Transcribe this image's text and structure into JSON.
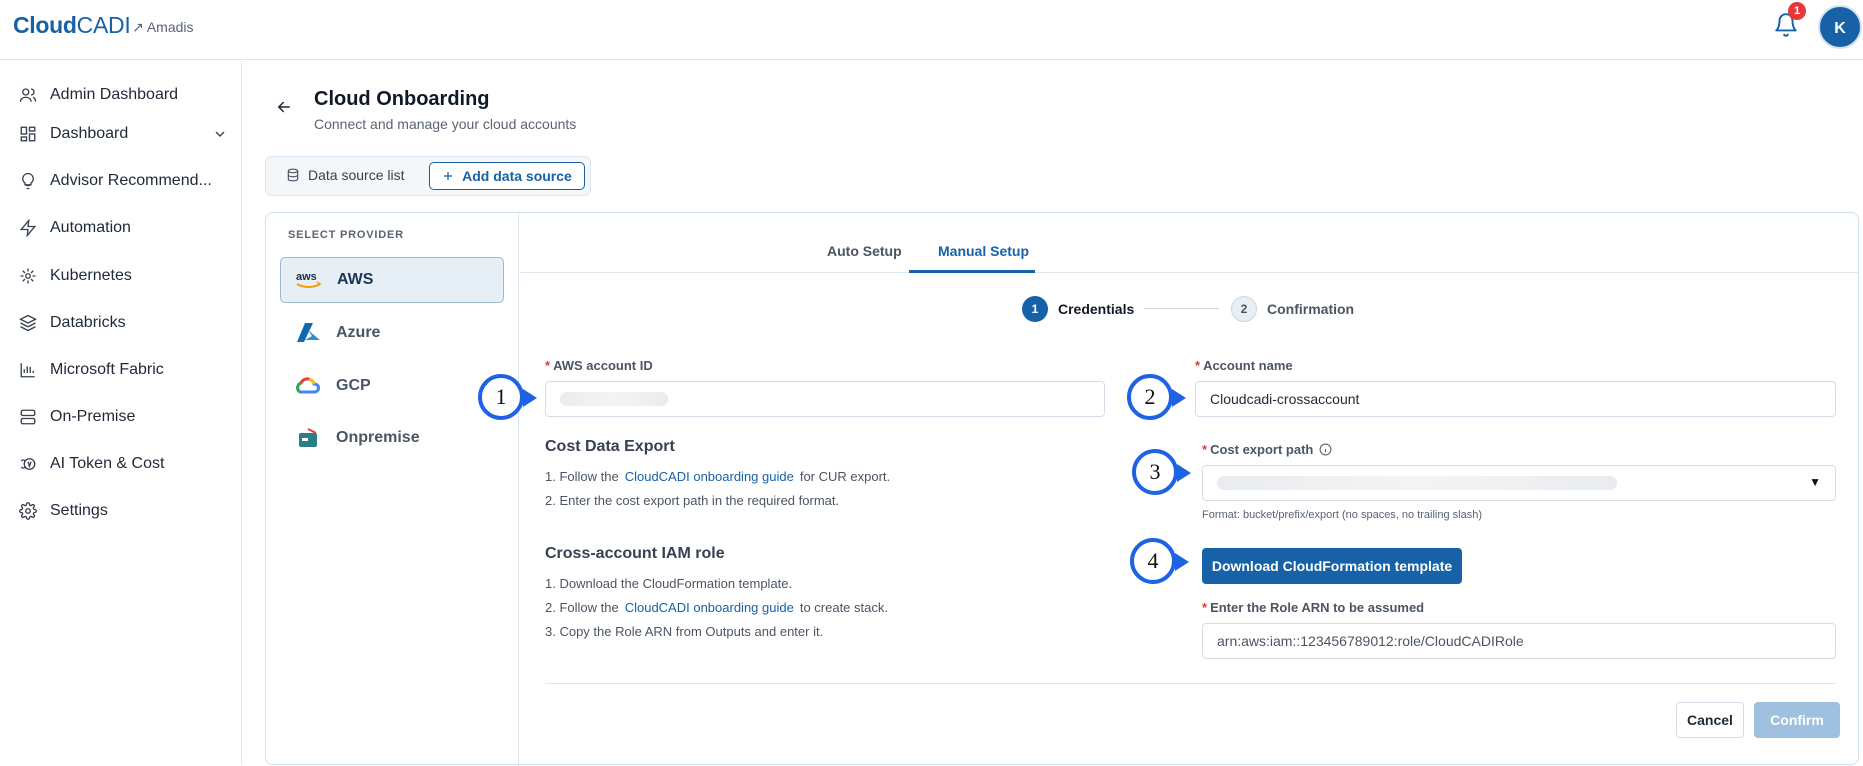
{
  "header": {
    "brand_bold": "Cloud",
    "brand_light": "CADI",
    "org": "↗ Amadis",
    "notification_count": "1",
    "avatar_initial": "K"
  },
  "sidebar": {
    "items": [
      {
        "label": "Admin Dashboard",
        "icon": "users-icon"
      },
      {
        "label": "Dashboard",
        "icon": "grid-icon"
      },
      {
        "label": "Advisor Recommend...",
        "icon": "bulb-icon"
      },
      {
        "label": "Automation",
        "icon": "bolt-icon"
      },
      {
        "label": "Kubernetes",
        "icon": "helm-icon"
      },
      {
        "label": "Databricks",
        "icon": "layers-icon"
      },
      {
        "label": "Microsoft Fabric",
        "icon": "bar-chart-icon"
      },
      {
        "label": "On-Premise",
        "icon": "server-icon"
      },
      {
        "label": "AI Token & Cost",
        "icon": "ai-coin-icon"
      },
      {
        "label": "Settings",
        "icon": "gear-icon"
      }
    ]
  },
  "page": {
    "title": "Cloud Onboarding",
    "subtitle": "Connect and manage your cloud accounts"
  },
  "ds_tabs": {
    "list_label": "Data source list",
    "add_label": "Add data source"
  },
  "providers": {
    "heading": "SELECT PROVIDER",
    "items": [
      {
        "label": "AWS",
        "logo_text": "aws"
      },
      {
        "label": "Azure"
      },
      {
        "label": "GCP"
      },
      {
        "label": "Onpremise"
      }
    ]
  },
  "tabs": {
    "auto": "Auto Setup",
    "manual": "Manual Setup"
  },
  "steps": [
    {
      "num": "1",
      "label": "Credentials"
    },
    {
      "num": "2",
      "label": "Confirmation"
    }
  ],
  "form": {
    "aws_account_id_label": "AWS account ID",
    "account_name_label": "Account name",
    "account_name_value": "Cloudcadi-crossaccount",
    "cost_export_label": "Cost export path",
    "cost_export_hint": "Format: bucket/prefix/export (no spaces, no trailing slash)",
    "download_button": "Download CloudFormation template",
    "role_arn_label": "Enter the Role ARN to be assumed",
    "role_arn_placeholder": "arn:aws:iam::123456789012:role/CloudCADIRole",
    "cancel": "Cancel",
    "confirm": "Confirm"
  },
  "cost_section": {
    "title": "Cost Data Export",
    "step1_pre": "1.  Follow the",
    "step1_link": "CloudCADI onboarding guide",
    "step1_post": "for CUR export.",
    "step2": "2.  Enter the cost export path in the required format."
  },
  "iam_section": {
    "title": "Cross-account IAM role",
    "step1": "1.  Download the CloudFormation template.",
    "step2_pre": "2.  Follow the",
    "step2_link": "CloudCADI onboarding guide",
    "step2_post": "to create stack.",
    "step3": "3.  Copy the Role ARN from Outputs and enter it."
  },
  "callouts": [
    "1",
    "2",
    "3",
    "4"
  ],
  "colors": {
    "accent": "#1762a7",
    "callout": "#1d63e4",
    "required": "#e5383b"
  }
}
